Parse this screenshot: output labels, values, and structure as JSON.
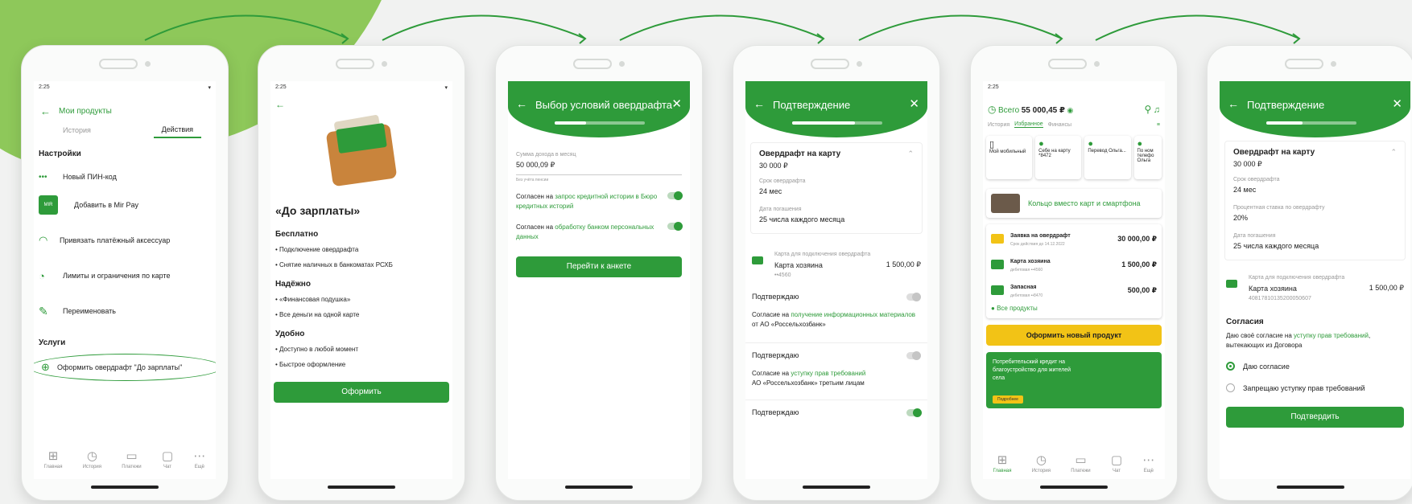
{
  "colors": {
    "accent": "#2e9b3a",
    "button_yellow": "#f2c316"
  },
  "p1": {
    "status_time": "2:25",
    "back_title": "Мои продукты",
    "tab1": "История",
    "tab2": "Действия",
    "settings": "Настройки",
    "pin": "Новый ПИН-код",
    "mirpay": "Добавить в Mir Pay",
    "accessory": "Привязать платёжный аксессуар",
    "limits": "Лимиты и ограничения по карте",
    "rename": "Переименовать",
    "services": "Услуги",
    "overdraft": "Оформить овердрафт \"До зарплаты\"",
    "nav": [
      "Главная",
      "История",
      "Платежи",
      "Чат",
      "Ещё"
    ]
  },
  "p2": {
    "status_time": "2:25",
    "title": "«До зарплаты»",
    "s1": "Бесплатно",
    "s1a": "Подключение овердрафта",
    "s1b": "Снятие наличных в банкоматах РСХБ",
    "s2": "Надёжно",
    "s2a": "«Финансовая подушка»",
    "s2b": "Все деньги на одной карте",
    "s3": "Удобно",
    "s3a": "Доступно в любой момент",
    "s3b": "Быстрое оформление",
    "btn": "Оформить"
  },
  "p3": {
    "title": "Выбор условий овердрафта",
    "income_label": "Сумма дохода в месяц",
    "income": "50 000,09 ₽",
    "note": "Без учёта пенсии",
    "c1_pre": "Согласен на ",
    "c1_link": "запрос кредитной истории в Бюро кредитных историй",
    "c2_pre": "Согласен на ",
    "c2_link": "обработку банком персональных данных",
    "btn": "Перейти к анкете"
  },
  "p4": {
    "title": "Подтверждение",
    "ov_title": "Овердрафт на карту",
    "ov_amount": "30 000 ₽",
    "term_label": "Срок овердрафта",
    "term": "24 мес",
    "date_label": "Дата погашения",
    "date": "25 числа каждого месяца",
    "card_label": "Карта для подключения овердрафта",
    "card_name": "Карта хозяина",
    "card_sum": "1 500,00 ₽",
    "card_num": "••4560",
    "confirm": "Подтверждаю",
    "a1_pre": "Согласие на ",
    "a1_link": "получение информационных материалов",
    "a1_post": " от АО «Россельхозбанк»",
    "a2_pre": "Согласие на ",
    "a2_link": "уступку прав требований",
    "a2_post": "АО «Россельхозбанк» третьим лицам"
  },
  "p5": {
    "status_time": "2:25",
    "total_label": "Всего",
    "total": "55 000,45 ₽",
    "tabs": [
      "История",
      "Избранное",
      "Финансы"
    ],
    "fav": [
      "Мой мобильный",
      "Себе на карту *8472",
      "Перевод Ольга...",
      "По ном телефо Ольга"
    ],
    "ring": "Кольцо вместо карт и смартфона",
    "items": [
      {
        "name": "Заявка на овердрафт",
        "sub": "Срок действия до 14.12.2022",
        "sum": "30 000,00 ₽"
      },
      {
        "name": "Карта хозяина",
        "sub": "дебетовая ••4560",
        "sum": "1 500,00 ₽"
      },
      {
        "name": "Запасная",
        "sub": "дебетовая ••8470",
        "sum": "500,00 ₽"
      }
    ],
    "all": "Все продукты",
    "new_btn": "Оформить новый продукт",
    "promo": "Потребительский кредит на благоустройство для жителей села",
    "promo_btn": "Подробнее",
    "nav": [
      "Главная",
      "История",
      "Платежи",
      "Чат",
      "Ещё"
    ]
  },
  "p6": {
    "title": "Подтверждение",
    "ov_title": "Овердрафт на карту",
    "ov_amount": "30 000 ₽",
    "term_label": "Срок овердрафта",
    "term": "24 мес",
    "rate_label": "Процентная ставка по овердрафту",
    "rate": "20%",
    "date_label": "Дата погашения",
    "date": "25 числа каждого месяца",
    "card_label": "Карта для подключения овердрафта",
    "card_name": "Карта хозяина",
    "card_sum": "1 500,00 ₽",
    "card_num": "40817810135200050607",
    "consent_title": "Согласия",
    "consent_pre": "Даю своё согласие на ",
    "consent_link": "уступку прав требований",
    "consent_post": ", вытекающих из Договора",
    "opt1": "Даю согласие",
    "opt2": "Запрещаю уступку прав требований",
    "btn": "Подтвердить"
  }
}
